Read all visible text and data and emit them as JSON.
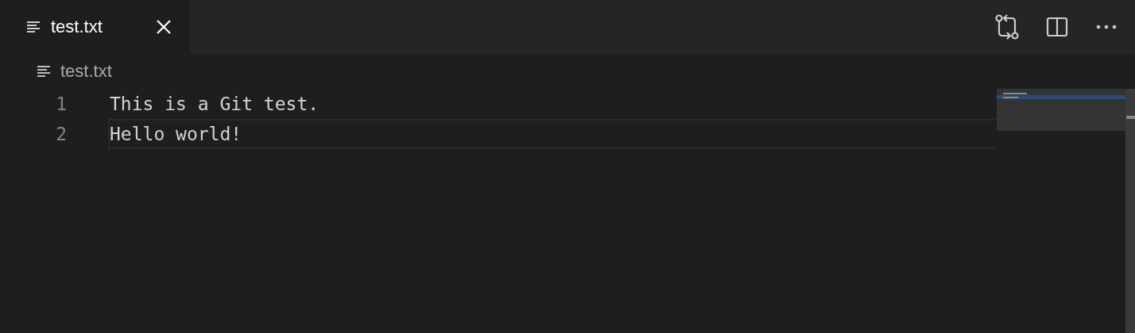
{
  "tabs": [
    {
      "label": "test.txt",
      "selected": true
    }
  ],
  "breadcrumb": "test.txt",
  "lines": [
    {
      "number": "1",
      "text": "This is a Git test.",
      "current": false
    },
    {
      "number": "2",
      "text": "Hello world!",
      "current": true
    }
  ]
}
